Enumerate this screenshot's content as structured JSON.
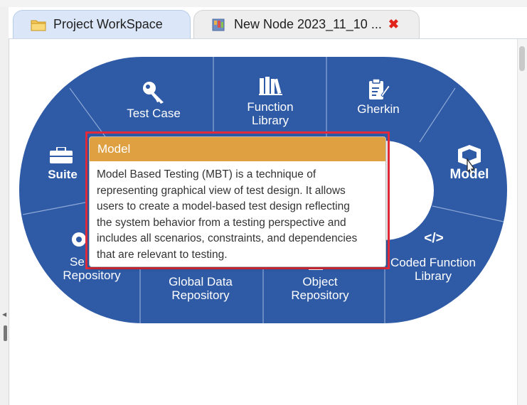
{
  "tabs": [
    {
      "label": "Project WorkSpace",
      "icon": "folder-icon",
      "active": true
    },
    {
      "label": "New Node 2023_11_10 ...",
      "icon": "node-icon",
      "active": false,
      "close": "✖"
    }
  ],
  "wheel": {
    "segments": [
      {
        "label_lines": [
          "Suite"
        ],
        "icon": "briefcase-icon"
      },
      {
        "label_lines": [
          "Test Case"
        ],
        "icon": "key-icon"
      },
      {
        "label_lines": [
          "Function",
          "Library"
        ],
        "icon": "books-icon"
      },
      {
        "label_lines": [
          "Gherkin"
        ],
        "icon": "clipboard-icon"
      },
      {
        "label_lines": [
          "Model"
        ],
        "icon": "model-box-icon",
        "hovered": true
      },
      {
        "label_lines": [
          "Coded Function",
          "Library"
        ],
        "icon": "code-icon",
        "icon_text": "</>"
      },
      {
        "label_lines": [
          "Object",
          "Repository"
        ],
        "icon": "object-icon"
      },
      {
        "label_lines": [
          "Global Data",
          "Repository"
        ],
        "icon": "database-icon"
      },
      {
        "label_lines": [
          "Se",
          "Repository"
        ],
        "icon": "gear-icon"
      }
    ]
  },
  "tooltip": {
    "title": "Model",
    "lines": [
      "Model Based Testing (MBT) is a technique of",
      "representing graphical view of test design. It allows",
      "users to create a model-based test design reflecting",
      "the system behavior from a testing perspective and",
      "includes all scenarios, constraints, and dependencies",
      "that are relevant to testing."
    ]
  },
  "colors": {
    "wheel_blue": "#2e5aa6",
    "tooltip_header": "#dfa042",
    "highlight_outline": "#e22a3a",
    "close_red": "#e0241b"
  }
}
